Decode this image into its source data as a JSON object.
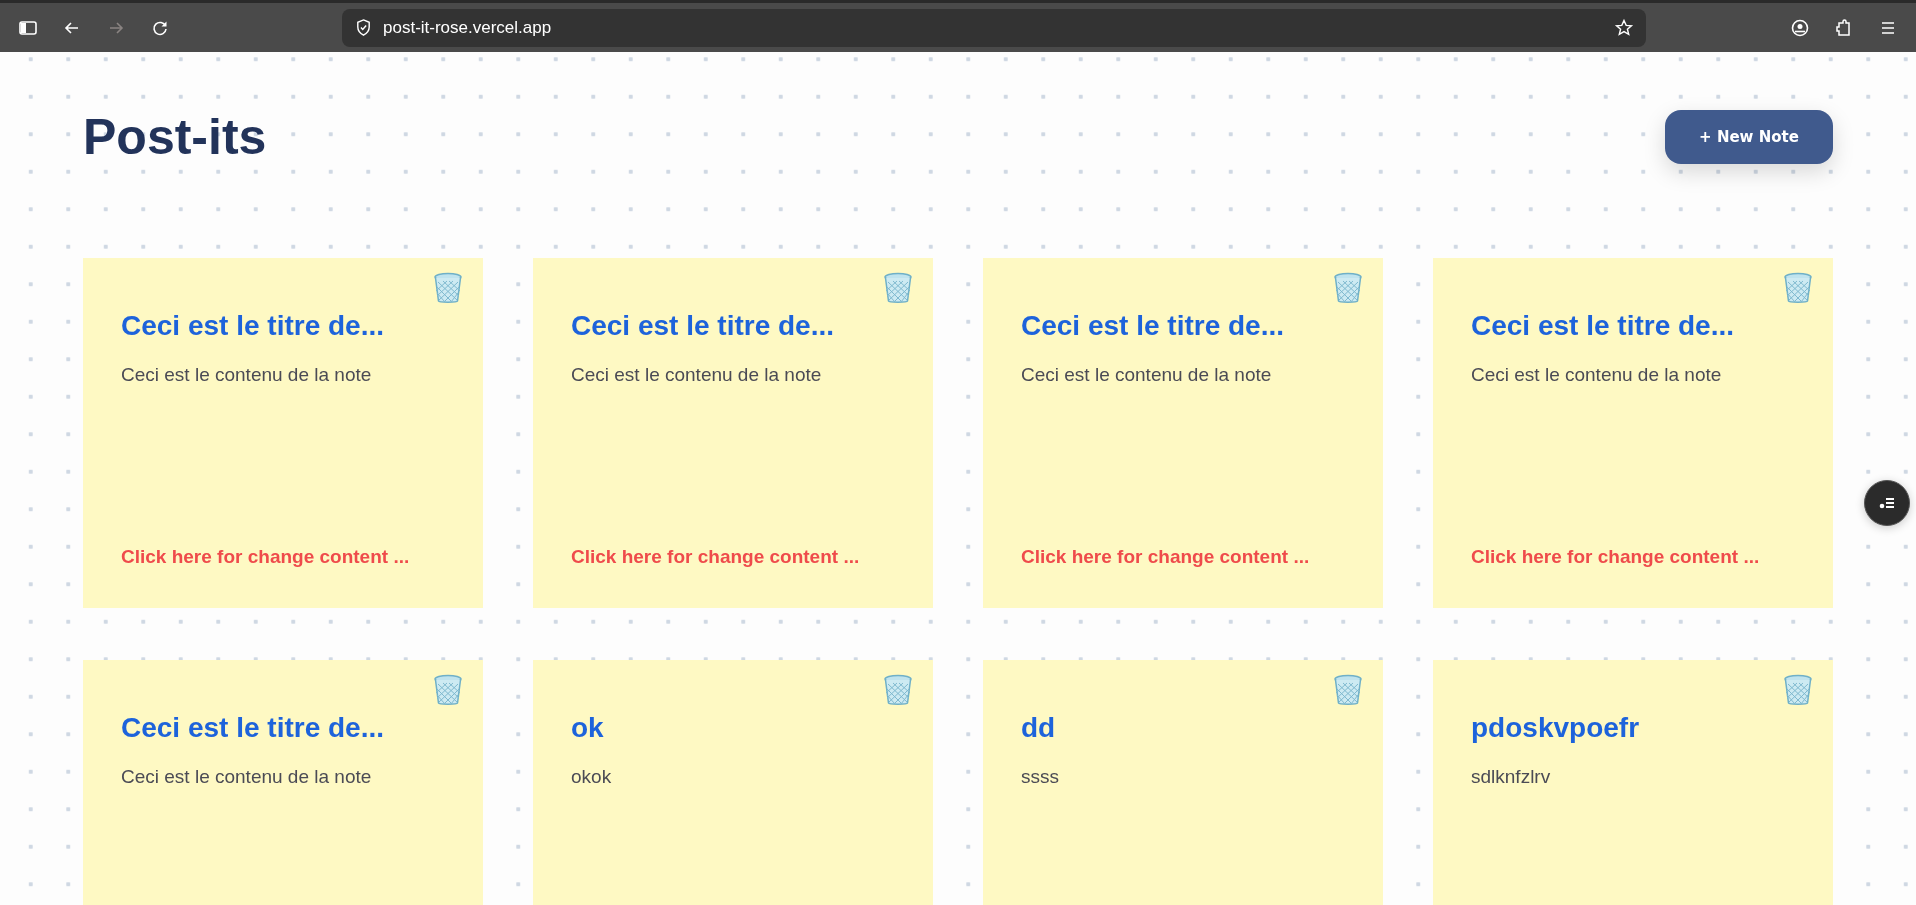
{
  "browser": {
    "url": "post-it-rose.vercel.app"
  },
  "page": {
    "title": "Post-its",
    "new_button": "+ New Note"
  },
  "notes": [
    {
      "title": "Ceci est le titre de...",
      "content": "Ceci est le contenu de la note",
      "link": "Click here for change content ..."
    },
    {
      "title": "Ceci est le titre de...",
      "content": "Ceci est le contenu de la note",
      "link": "Click here for change content ..."
    },
    {
      "title": "Ceci est le titre de...",
      "content": "Ceci est le contenu de la note",
      "link": "Click here for change content ..."
    },
    {
      "title": "Ceci est le titre de...",
      "content": "Ceci est le contenu de la note",
      "link": "Click here for change content ..."
    },
    {
      "title": "Ceci est le titre de...",
      "content": "Ceci est le contenu de la note"
    },
    {
      "title": "ok",
      "content": "okok"
    },
    {
      "title": "dd",
      "content": "ssss"
    },
    {
      "title": "pdoskvpoefr",
      "content": "sdlknfzlrv"
    }
  ]
}
